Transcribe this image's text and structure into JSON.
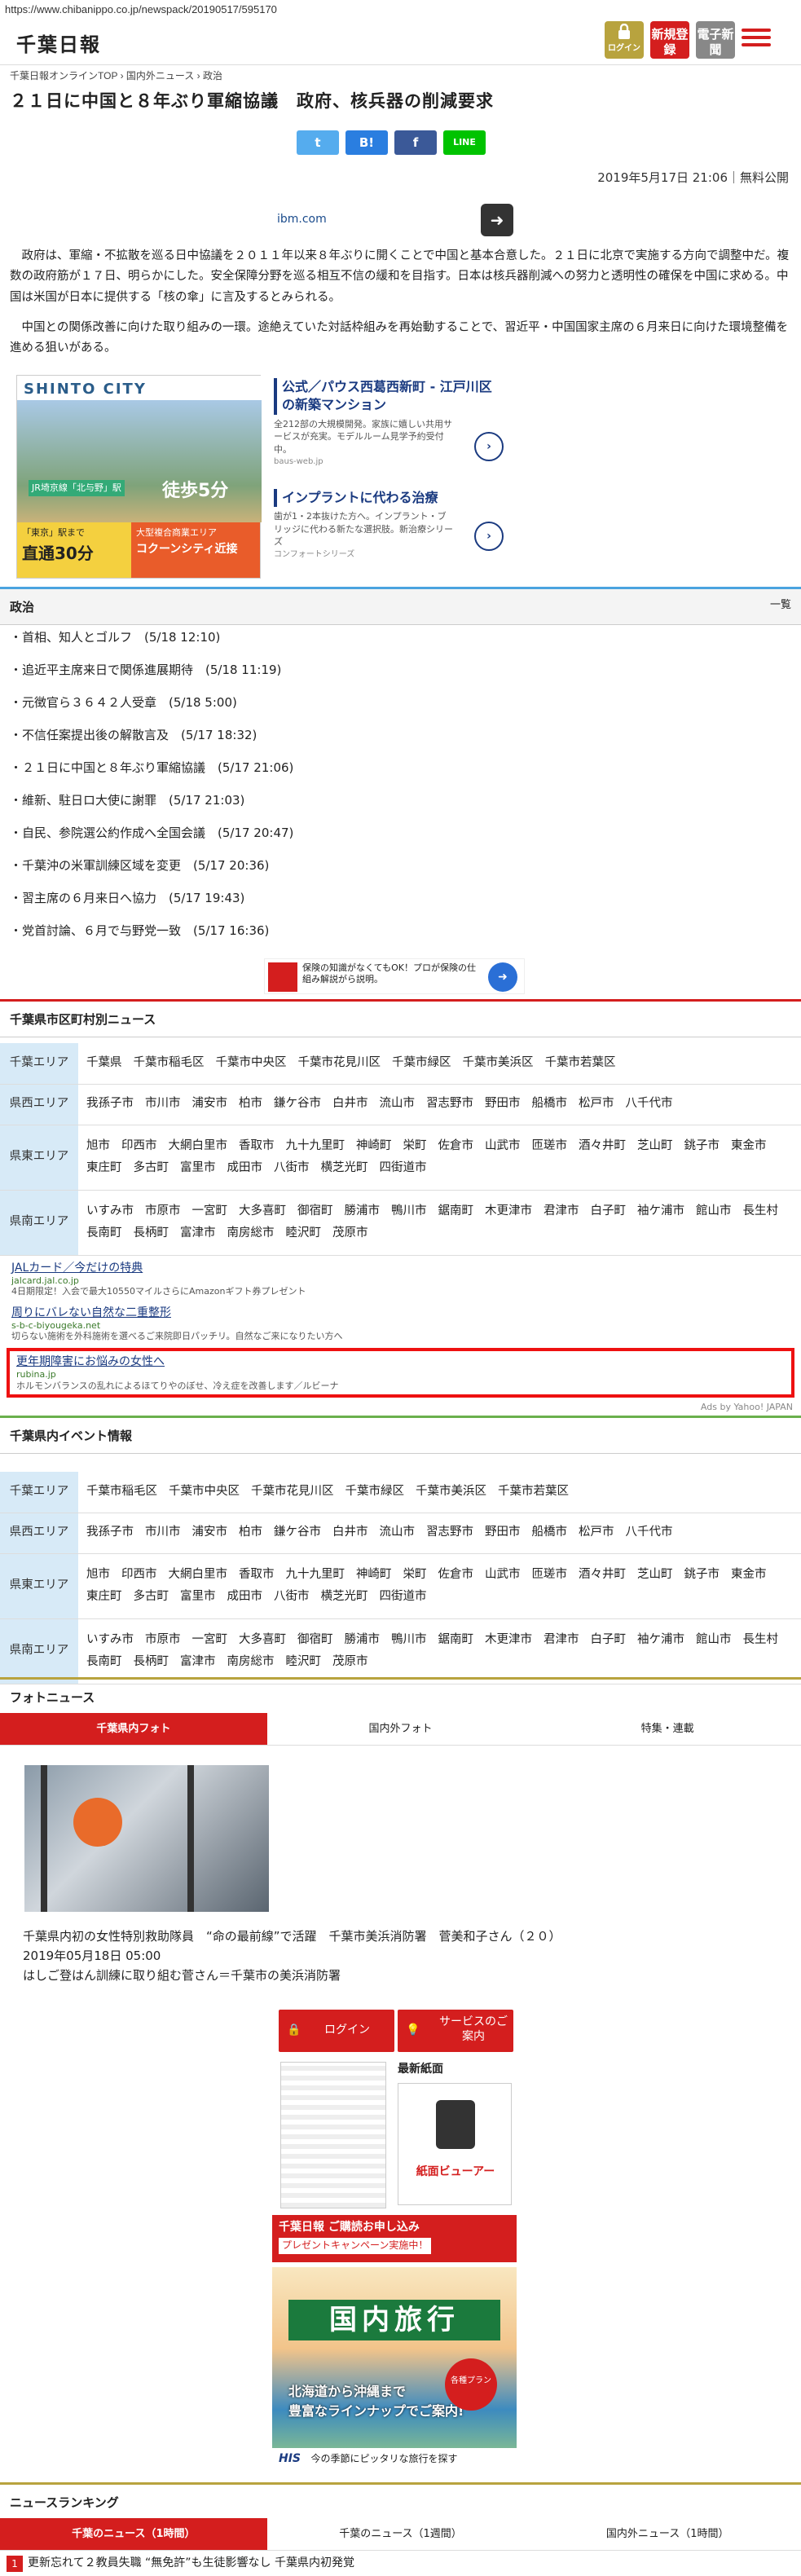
{
  "url": "https://www.chibanippo.co.jp/newspack/20190517/595170",
  "header": {
    "logo": "千葉日報",
    "login": "ログイン",
    "register": "新規登録",
    "paper": "電子新聞"
  },
  "breadcrumb": "千葉日報オンラインTOP › 国内外ニュース › 政治",
  "article": {
    "title": "２１日に中国と８年ぶり軍縮協議　政府、核兵器の削減要求",
    "date": "2019年5月17日 21:06｜無料公開",
    "p1": "　政府は、軍縮・不拡散を巡る日中協議を２０１１年以来８年ぶりに開くことで中国と基本合意した。２１日に北京で実施する方向で調整中だ。複数の政府筋が１７日、明らかにした。安全保障分野を巡る相互不信の緩和を目指す。日本は核兵器削減への努力と透明性の確保を中国に求める。中国は米国が日本に提供する「核の傘」に言及するとみられる。",
    "p2": "　中国との関係改善に向けた取り組みの一環。途絶えていた対話枠組みを再始動することで、習近平・中国国家主席の６月来日に向けた環境整備を進める狙いがある。"
  },
  "share": {
    "twitter": "t",
    "hatena": "B!",
    "facebook": "f",
    "line": "LINE"
  },
  "ads": {
    "ibm": "ibm.com",
    "shinto_title": "SHINTO CITY",
    "shinto_tag1": "「東京」駅まで",
    "shinto_tag2": "直通30分",
    "shinto_tag3": "大型複合商業エリア",
    "shinto_tag4": "コクーンシティ近接",
    "shinto_walk": "JR埼京線「北与野」駅",
    "shinto_walk2": "徒歩5分",
    "item1_title": "公式／パウス西葛西新町 - 江戸川区の新築マンション",
    "item1_desc": "全212部の大規模開発。家族に嬉しい共用サービスが充実。モデルルーム見学予約受付中。",
    "item1_src": "baus-web.jp",
    "item2_title": "インプラントに代わる治療",
    "item2_desc": "歯が1・2本抜けた方へ。インプラント・ブリッジに代わる新たな選択肢。新治療シリーズ",
    "item2_src": "コンフォートシリーズ",
    "insure": "保険の知識がなくてもOK！プロが保険の仕組み解説がら説明。",
    "text_ads": [
      {
        "title": "JALカード／今だけの特典",
        "url": "jalcard.jal.co.jp",
        "desc": "4日期限定！入会で最大10550マイルさらにAmazonギフト券プレゼント"
      },
      {
        "title": "周りにバレない自然な二重整形",
        "url": "s-b-c-biyougeka.net",
        "desc": "切らない施術を外科施術を選べるご来院即日パッチリ。自然なご来になりたい方へ"
      },
      {
        "title": "更年期障害にお悩みの女性へ",
        "url": "rubina.jp",
        "desc": "ホルモンバランスの乱れによるほてりやのぼせ、冷え症を改善します／ルビーナ"
      }
    ],
    "yahoo": "Ads by Yahoo! JAPAN"
  },
  "politics": {
    "heading": "政治",
    "all": "一覧",
    "items": [
      "首相、知人とゴルフ　(5/18 12:10)",
      "追近平主席来日で関係進展期待　(5/18 11:19)",
      "元徴官ら３６４２人受章　(5/18 5:00)",
      "不信任案提出後の解散言及　(5/17 18:32)",
      "２１日に中国と８年ぶり軍縮協議　(5/17 21:06)",
      "維新、駐日ロ大使に謝罪　(5/17 21:03)",
      "自民、参院選公約作成へ全国会議　(5/17 20:47)",
      "千葉沖の米軍訓練区域を変更　(5/17 20:36)",
      "習主席の６月来日へ協力　(5/17 19:43)",
      "党首討論、６月で与野党一致　(5/17 16:36)"
    ]
  },
  "municipal": {
    "heading": "千葉県市区町村別ニュース",
    "rows": [
      {
        "label": "千葉エリア",
        "towns": [
          "千葉県",
          "千葉市稲毛区",
          "千葉市中央区",
          "千葉市花見川区",
          "千葉市緑区",
          "千葉市美浜区",
          "千葉市若葉区"
        ]
      },
      {
        "label": "県西エリア",
        "towns": [
          "我孫子市",
          "市川市",
          "浦安市",
          "柏市",
          "鎌ケ谷市",
          "白井市",
          "流山市",
          "習志野市",
          "野田市",
          "船橋市",
          "松戸市",
          "八千代市"
        ]
      },
      {
        "label": "県東エリア",
        "towns": [
          "旭市",
          "印西市",
          "大網白里市",
          "香取市",
          "九十九里町",
          "神崎町",
          "栄町",
          "佐倉市",
          "山武市",
          "匝瑳市",
          "酒々井町",
          "芝山町",
          "銚子市",
          "東金市",
          "東庄町",
          "多古町",
          "富里市",
          "成田市",
          "八街市",
          "横芝光町",
          "四街道市"
        ]
      },
      {
        "label": "県南エリア",
        "towns": [
          "いすみ市",
          "市原市",
          "一宮町",
          "大多喜町",
          "御宿町",
          "勝浦市",
          "鴨川市",
          "鋸南町",
          "木更津市",
          "君津市",
          "白子町",
          "袖ケ浦市",
          "館山市",
          "長生村",
          "長南町",
          "長柄町",
          "富津市",
          "南房総市",
          "睦沢町",
          "茂原市"
        ]
      }
    ]
  },
  "events": {
    "heading": "千葉県内イベント情報",
    "rows": [
      {
        "label": "千葉エリア",
        "towns": [
          "千葉市稲毛区",
          "千葉市中央区",
          "千葉市花見川区",
          "千葉市緑区",
          "千葉市美浜区",
          "千葉市若葉区"
        ]
      },
      {
        "label": "県西エリア",
        "towns": [
          "我孫子市",
          "市川市",
          "浦安市",
          "柏市",
          "鎌ケ谷市",
          "白井市",
          "流山市",
          "習志野市",
          "野田市",
          "船橋市",
          "松戸市",
          "八千代市"
        ]
      },
      {
        "label": "県東エリア",
        "towns": [
          "旭市",
          "印西市",
          "大網白里市",
          "香取市",
          "九十九里町",
          "神崎町",
          "栄町",
          "佐倉市",
          "山武市",
          "匝瑳市",
          "酒々井町",
          "芝山町",
          "銚子市",
          "東金市",
          "東庄町",
          "多古町",
          "富里市",
          "成田市",
          "八街市",
          "横芝光町",
          "四街道市"
        ]
      },
      {
        "label": "県南エリア",
        "towns": [
          "いすみ市",
          "市原市",
          "一宮町",
          "大多喜町",
          "御宿町",
          "勝浦市",
          "鴨川市",
          "鋸南町",
          "木更津市",
          "君津市",
          "白子町",
          "袖ケ浦市",
          "館山市",
          "長生村",
          "長南町",
          "長柄町",
          "富津市",
          "南房総市",
          "睦沢町",
          "茂原市"
        ]
      }
    ]
  },
  "photo": {
    "heading": "フォトニュース",
    "tabs": [
      "千葉県内フォト",
      "国内外フォト",
      "特集・連載"
    ],
    "caption": "千葉県内初の女性特別救助隊員　“命の最前線”で活躍　千葉市美浜消防署　菅美和子さん（２０）",
    "date": "2019年05月18日 05:00",
    "sub": "はしご登はん訓練に取り組む菅さん＝千葉市の美浜消防署"
  },
  "side": {
    "login": "ログイン",
    "service": "サービスのご案内",
    "latest": "最新紙面",
    "viewer": "紙面ビューアー",
    "sub_banner": "千葉日報 ご購読お申し込み",
    "sub_banner2": "プレゼントキャンペーン実施中！",
    "travel_title": "国内旅行",
    "travel_sub1": "北海道から沖縄まで",
    "travel_sub2": "豊富なラインナップでご案内!",
    "travel_badge": "各種プラン",
    "his": "HIS",
    "his_tag": "今の季節にピッタリな旅行を探す"
  },
  "ranking": {
    "heading": "ニュースランキング",
    "tabs": [
      "千葉のニュース（1時間）",
      "千葉のニュース（1週間）",
      "国内外ニュース（1時間）"
    ],
    "first_no": "1",
    "first": "更新忘れて２教員失職 “無免許”も生徒影響なし 千葉県内初発覚"
  }
}
